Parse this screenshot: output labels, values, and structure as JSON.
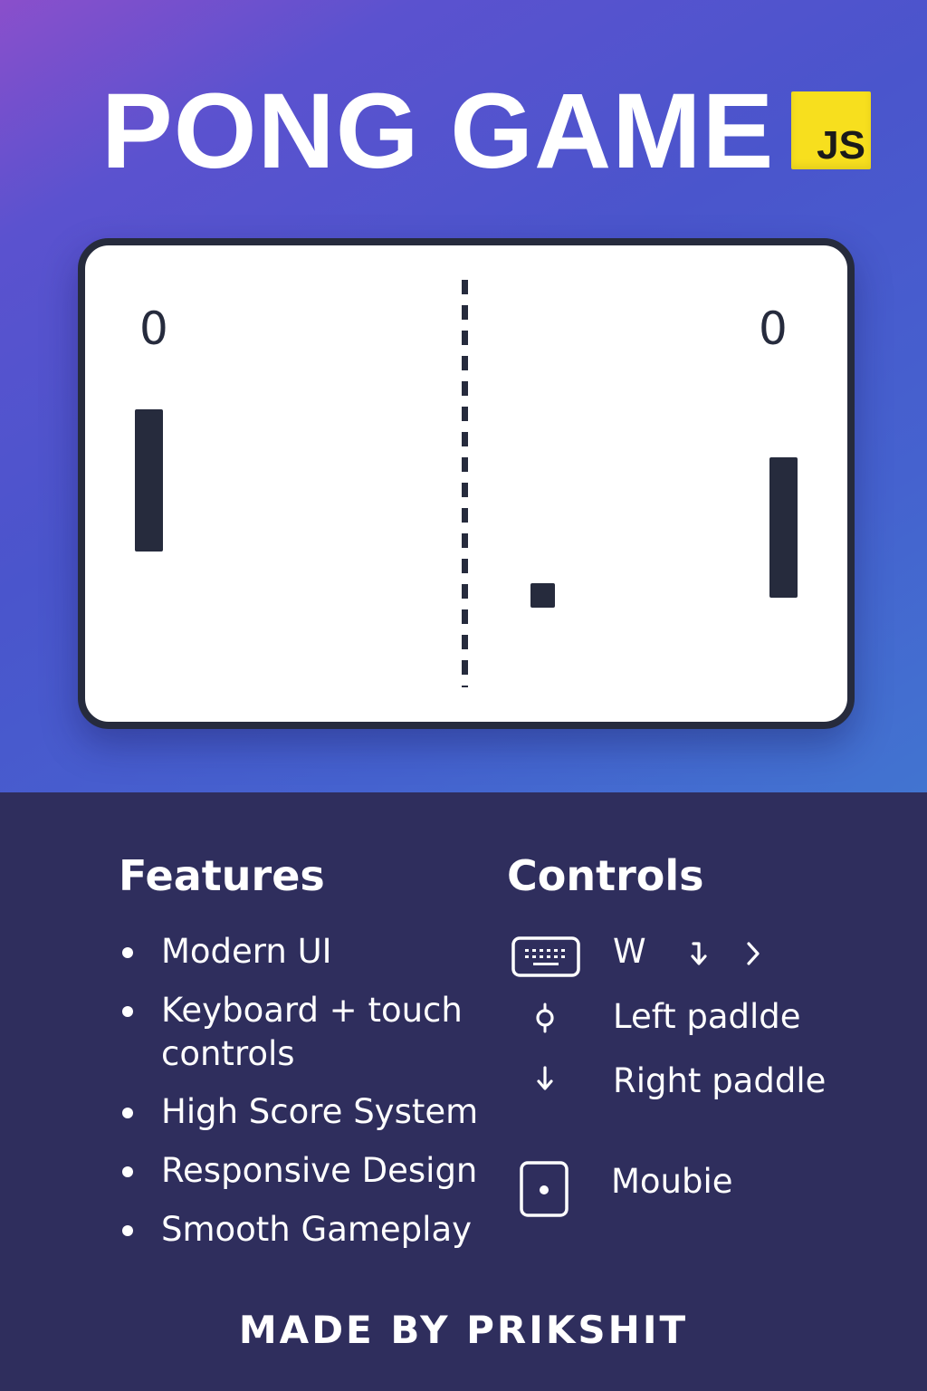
{
  "title": "PONG GAME",
  "badge": "JS",
  "colors": {
    "background_top": "#5b52cf",
    "background_bottom": "#2f2e5d",
    "court": "#ffffff",
    "court_ink": "#262b3d",
    "badge": "#f7df1e"
  },
  "game": {
    "score_left": "0",
    "score_right": "0"
  },
  "features": {
    "heading": "Features",
    "items": [
      "Modern UI",
      "Keyboard + touch controls",
      "High Score System",
      "Responsive Design",
      "Smooth Gameplay"
    ]
  },
  "controls": {
    "heading": "Controls",
    "rows": [
      {
        "icon": "keyboard-icon",
        "key": "W",
        "extra_icons": [
          "arrow-down-icon",
          "chevron-right-icon"
        ]
      },
      {
        "icon": "knob-icon",
        "label": "Left padlde"
      },
      {
        "icon": "arrow-down-icon",
        "label": "Right paddle"
      },
      {
        "icon": "mobile-icon",
        "label": "Moubie"
      }
    ]
  },
  "footer": "MADE BY PRIKSHIT"
}
